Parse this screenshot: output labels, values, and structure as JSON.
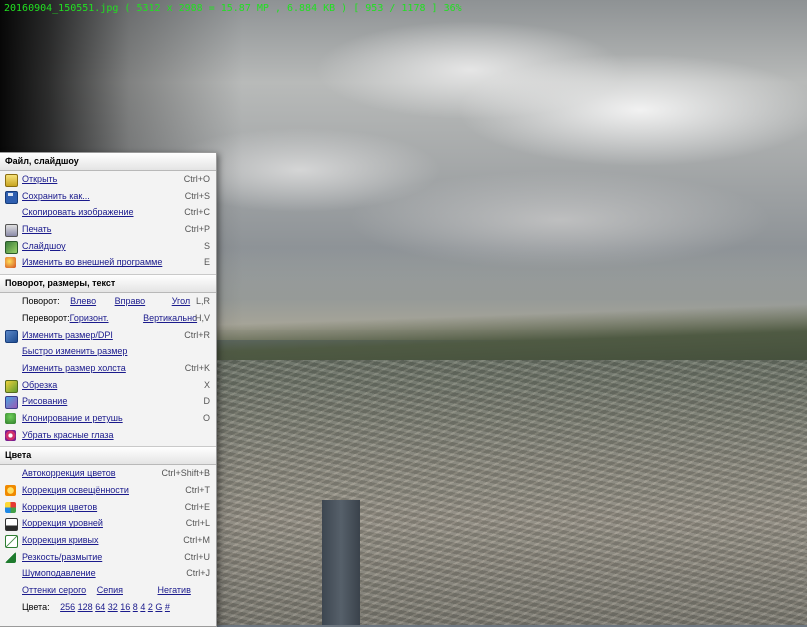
{
  "info_bar": {
    "filename": "20160904_150551.jpg",
    "dimensions": "( 5312 x 2988 = 15.87 MP",
    "filesize": ",  6.884 KB )",
    "position": "[ 953 / 1178 ]",
    "zoom": "36%"
  },
  "colors": {
    "info_text": "#21e021",
    "menu_background": "#f3f3f3",
    "link_text": "#1a1a8c"
  },
  "menu": {
    "file_section": {
      "title": "Файл, слайдшоу",
      "items": [
        {
          "label": "Открыть",
          "shortcut": "Ctrl+O",
          "icon": "open-folder-icon"
        },
        {
          "label": "Сохранить как...",
          "shortcut": "Ctrl+S",
          "icon": "floppy-disk-icon"
        },
        {
          "label": "Скопировать изображение",
          "shortcut": "Ctrl+C"
        },
        {
          "label": "Печать",
          "shortcut": "Ctrl+P",
          "icon": "printer-icon"
        },
        {
          "label": "Слайдшоу",
          "shortcut": "S",
          "icon": "slideshow-icon"
        },
        {
          "label": "Изменить во внешней программе",
          "shortcut": "E",
          "icon": "external-program-icon"
        }
      ]
    },
    "transform_section": {
      "title": "Поворот, размеры, текст",
      "rotate": {
        "label": "Поворот:",
        "left": "Влево",
        "right": "Вправо",
        "angle": "Угол",
        "shortcut": "L,R"
      },
      "flip": {
        "label": "Переворот:",
        "horizontal": "Горизонт.",
        "vertical": "Вертикально",
        "shortcut": "H,V"
      },
      "items": [
        {
          "label": "Изменить размер/DPI",
          "shortcut": "Ctrl+R",
          "icon": "resize-icon"
        },
        {
          "label": "Быстро изменить размер",
          "shortcut": ""
        },
        {
          "label": "Изменить размер холста",
          "shortcut": "Ctrl+K"
        },
        {
          "label": "Обрезка",
          "shortcut": "X",
          "icon": "crop-icon"
        },
        {
          "label": "Рисование",
          "shortcut": "D",
          "icon": "drawing-icon"
        },
        {
          "label": "Клонирование и ретушь",
          "shortcut": "O",
          "icon": "clone-stamp-icon"
        },
        {
          "label": "Убрать красные глаза",
          "shortcut": "",
          "icon": "red-eye-icon"
        }
      ]
    },
    "color_section": {
      "title": "Цвета",
      "items": [
        {
          "label": "Автокоррекция цветов",
          "shortcut": "Ctrl+Shift+B"
        },
        {
          "label": "Коррекция освещённости",
          "shortcut": "Ctrl+T",
          "icon": "sun-icon"
        },
        {
          "label": "Коррекция цветов",
          "shortcut": "Ctrl+E",
          "icon": "color-palette-icon"
        },
        {
          "label": "Коррекция уровней",
          "shortcut": "Ctrl+L",
          "icon": "levels-icon"
        },
        {
          "label": "Коррекция кривых",
          "shortcut": "Ctrl+M",
          "icon": "curves-icon"
        },
        {
          "label": "Резкость/размытие",
          "shortcut": "Ctrl+U",
          "icon": "sharpen-icon"
        },
        {
          "label": "Шумоподавление",
          "shortcut": "Ctrl+J"
        }
      ],
      "grayscale": {
        "label": "Оттенки серого",
        "sepia": "Сепия",
        "negative": "Негатив"
      },
      "color_depth": {
        "label": "Цвета:",
        "options": [
          "256",
          "128",
          "64",
          "32",
          "16",
          "8",
          "4",
          "2",
          "G",
          "#"
        ]
      }
    }
  }
}
